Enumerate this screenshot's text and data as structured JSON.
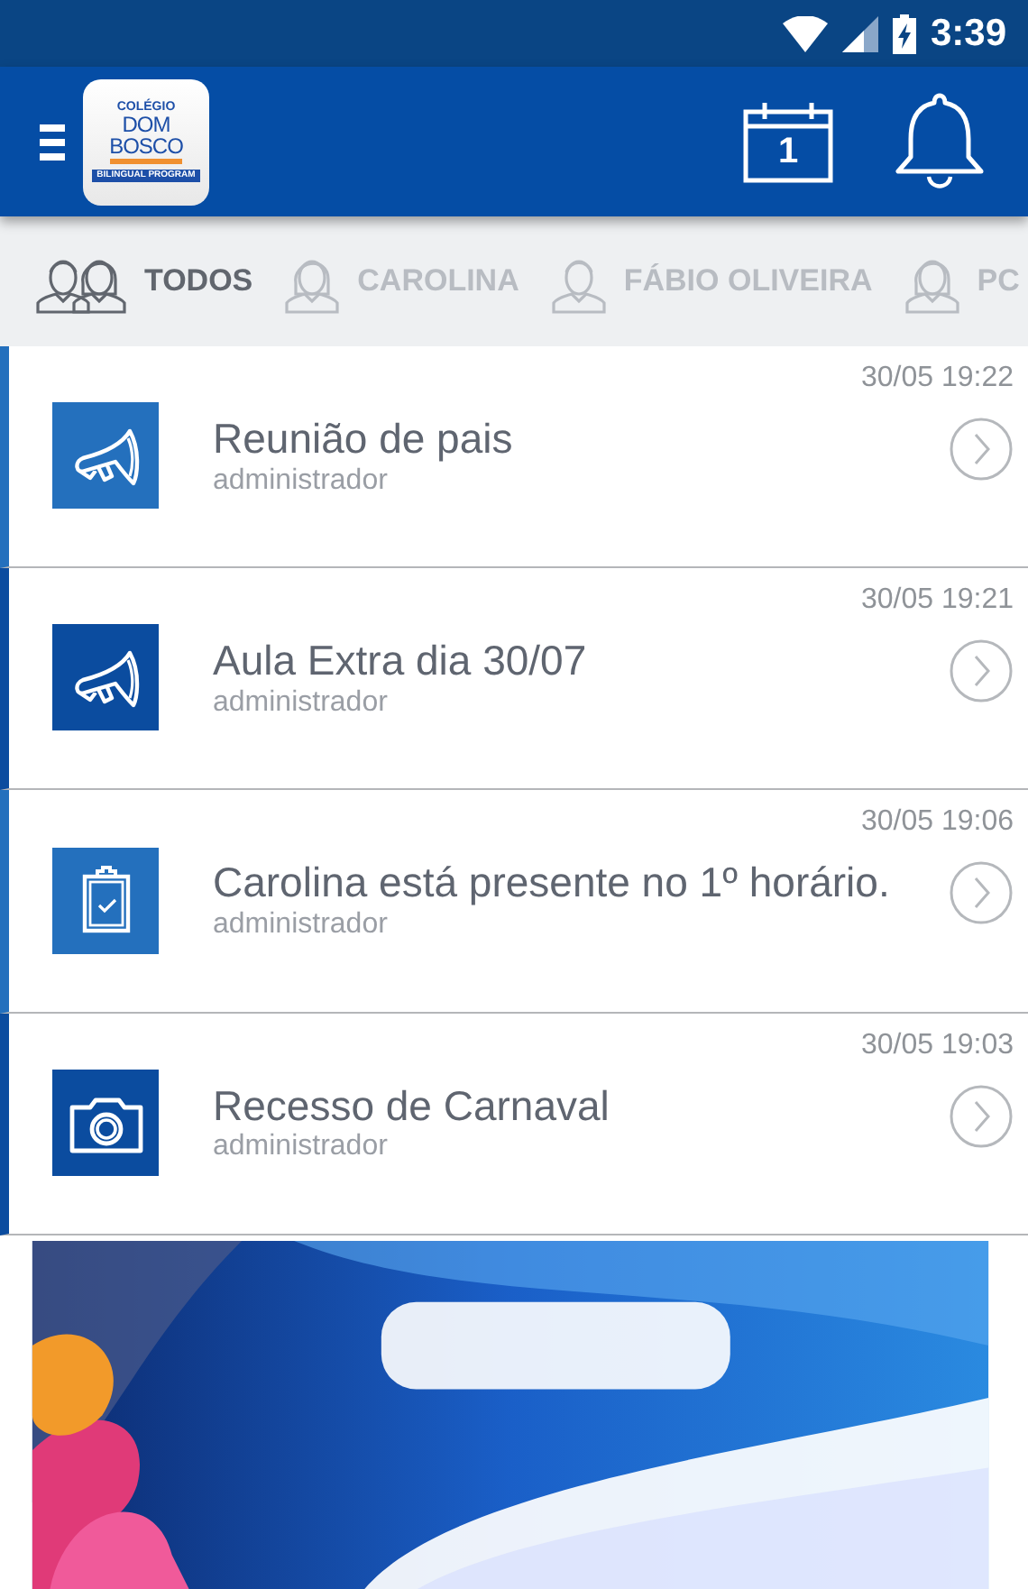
{
  "status_bar": {
    "time": "3:39"
  },
  "app_bar": {
    "logo": {
      "line_1": "COLÉGIO",
      "line_2": "DOM",
      "line_3": "BOSCO",
      "banner": "BILINGUAL PROGRAM"
    },
    "calendar_day": "1"
  },
  "tabs": [
    {
      "label": "TODOS",
      "kind": "group",
      "selected": true
    },
    {
      "label": "CAROLINA",
      "kind": "girl",
      "selected": false
    },
    {
      "label": "FÁBIO OLIVEIRA",
      "kind": "boy",
      "selected": false
    },
    {
      "label": "PC",
      "kind": "girl",
      "selected": false
    }
  ],
  "messages": [
    {
      "kind": "megaphone",
      "color": "#2470bd",
      "title": "Reunião de pais",
      "author": "administrador",
      "time": "30/05 19:22"
    },
    {
      "kind": "megaphone",
      "color": "#0b4c9f",
      "title": "Aula Extra dia 30/07",
      "author": "administrador",
      "time": "30/05 19:21"
    },
    {
      "kind": "clipboard",
      "color": "#2470bd",
      "title": "Carolina está presente no 1º horário.",
      "author": "administrador",
      "time": "30/05 19:06"
    },
    {
      "kind": "camera",
      "color": "#0b4c9f",
      "title": "Recesso de Carnaval",
      "author": "administrador",
      "time": "30/05 19:03"
    }
  ]
}
